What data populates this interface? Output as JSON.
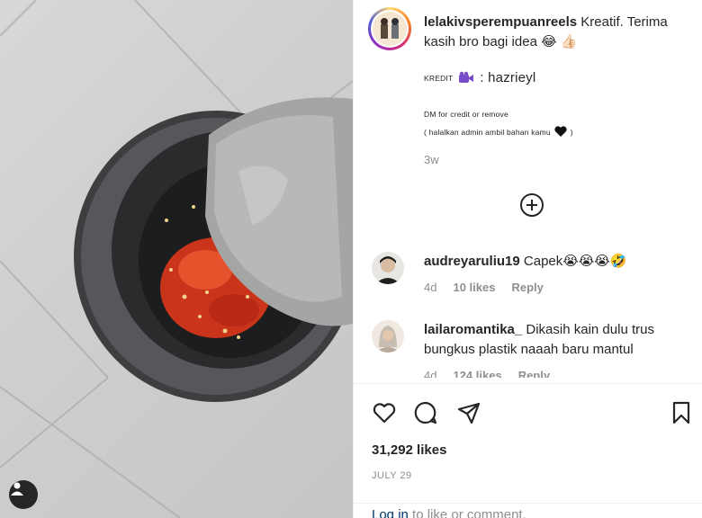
{
  "post": {
    "username": "lelakivsperempuanreels",
    "caption_text": "Kreatif. Terima kasih bro bagi idea 😂 👍🏻",
    "kredit_label": "KREDIT",
    "kredit_name": ": hazrieyl",
    "dm_text": "DM for credit or remove",
    "paren_text": "( halalkan admin ambil bahan kamu",
    "paren_close": ")",
    "time_ago": "3w",
    "likes": "31,292 likes",
    "date": "JULY 29"
  },
  "comments": [
    {
      "username": "audreyaruliu19",
      "text": "Capek😭😭😭🤣",
      "time": "4d",
      "likes": "10 likes",
      "reply": "Reply"
    },
    {
      "username": "lailaromantika_",
      "text": "Dikasih kain dulu trus bungkus plastik naaah baru mantul",
      "time": "4d",
      "likes": "124 likes",
      "reply": "Reply"
    }
  ],
  "login": {
    "link": "Log in",
    "rest": " to like or comment."
  },
  "icons": [
    "heart-icon",
    "comment-icon",
    "share-icon",
    "bookmark-icon",
    "plus-circle-icon",
    "user-tag-icon",
    "video-camera-icon",
    "black-heart-icon"
  ]
}
